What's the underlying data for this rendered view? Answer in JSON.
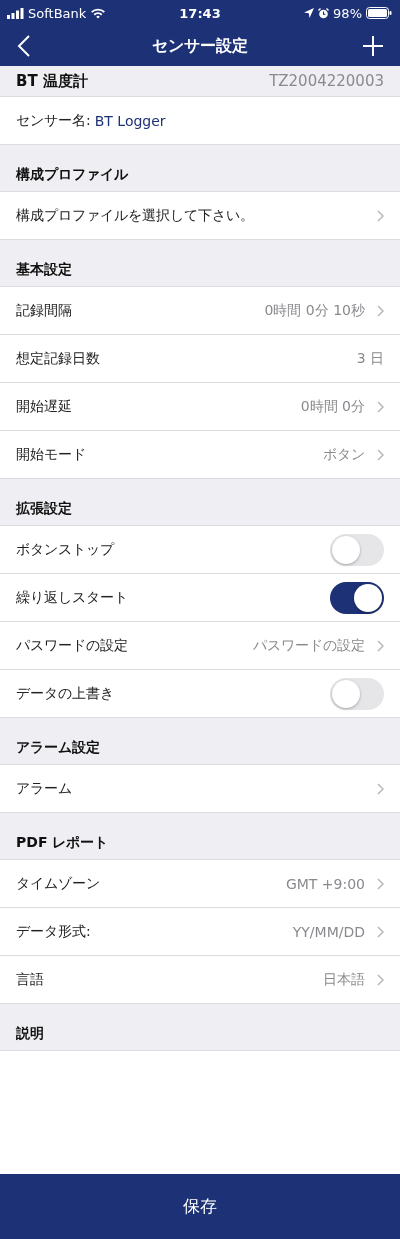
{
  "status_bar": {
    "carrier": "SoftBank",
    "time": "17:43",
    "battery": "98%"
  },
  "nav": {
    "title": "センサー設定"
  },
  "device": {
    "name": "BT 温度計",
    "serial": "TZ2004220003"
  },
  "sensor_name": {
    "label": "センサー名:",
    "value": "BT Logger"
  },
  "sections": [
    {
      "title": "構成プロファイル",
      "rows": [
        {
          "kind": "link",
          "label": "構成プロファイルを選択して下さい。"
        }
      ]
    },
    {
      "title": "基本設定",
      "rows": [
        {
          "kind": "link",
          "label": "記録間隔",
          "value": "0時間 0分 10秒"
        },
        {
          "kind": "value",
          "label": "想定記録日数",
          "value": "3 日"
        },
        {
          "kind": "link",
          "label": "開始遅延",
          "value": "0時間 0分"
        },
        {
          "kind": "link",
          "label": "開始モード",
          "value": "ボタン"
        }
      ]
    },
    {
      "title": "拡張設定",
      "rows": [
        {
          "kind": "toggle",
          "label": "ボタンストップ",
          "on": false
        },
        {
          "kind": "toggle",
          "label": "繰り返しスタート",
          "on": true
        },
        {
          "kind": "link",
          "label": "パスワードの設定",
          "value": "パスワードの設定"
        },
        {
          "kind": "toggle",
          "label": "データの上書き",
          "on": false
        }
      ]
    },
    {
      "title": "アラーム設定",
      "rows": [
        {
          "kind": "link",
          "label": "アラーム"
        }
      ]
    },
    {
      "title": "PDF レポート",
      "rows": [
        {
          "kind": "link",
          "label": "タイムゾーン",
          "value": "GMT +9:00"
        },
        {
          "kind": "link",
          "label": "データ形式:",
          "value": "YY/MM/DD"
        },
        {
          "kind": "link",
          "label": "言語",
          "value": "日本語"
        }
      ]
    },
    {
      "title": "説明"
    }
  ],
  "save_button": {
    "label": "保存"
  }
}
